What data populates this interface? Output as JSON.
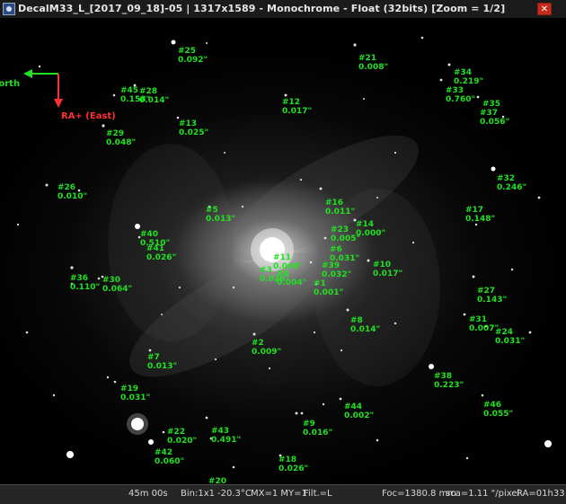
{
  "window": {
    "title": "DecalM33_L_[2017_09_18]-05 | 1317x1589 - Monochrome - Float (32bits)   [Zoom = 1/2]",
    "close_label": "✕"
  },
  "compass": {
    "north_label": "North",
    "east_label": "RA+ (East)",
    "north_color": "#22e022",
    "east_color": "#ff3030"
  },
  "stars": [
    {
      "id": "#25",
      "value": "0.092\""
    },
    {
      "id": "#21",
      "value": "0.008\""
    },
    {
      "id": "#34",
      "value": "0.219\""
    },
    {
      "id": "#33",
      "value": "0.760\""
    },
    {
      "id": "#35",
      "value": ""
    },
    {
      "id": "#37",
      "value": "0.056\""
    },
    {
      "id": "#45",
      "value": "0.158\""
    },
    {
      "id": "#28",
      "value": "0.014\""
    },
    {
      "id": "#12",
      "value": "0.017\""
    },
    {
      "id": "#13",
      "value": "0.025\""
    },
    {
      "id": "#29",
      "value": "0.048\""
    },
    {
      "id": "#32",
      "value": "0.246\""
    },
    {
      "id": "#26",
      "value": "0.010\""
    },
    {
      "id": "#16",
      "value": "0.011\""
    },
    {
      "id": "#5",
      "value": "0.013\""
    },
    {
      "id": "#17",
      "value": "0.148\""
    },
    {
      "id": "#14",
      "value": "0.000\""
    },
    {
      "id": "#23",
      "value": "0.005\""
    },
    {
      "id": "#40",
      "value": "0.510\""
    },
    {
      "id": "#41",
      "value": "0.026\""
    },
    {
      "id": "#6",
      "value": "0.031\""
    },
    {
      "id": "#11",
      "value": "0.008\""
    },
    {
      "id": "#39",
      "value": "0.032\""
    },
    {
      "id": "#10",
      "value": "0.017\""
    },
    {
      "id": "#3",
      "value": "0.026\""
    },
    {
      "id": "#4",
      "value": "0.004\""
    },
    {
      "id": "#36",
      "value": "0.110\""
    },
    {
      "id": "#30",
      "value": "0.064\""
    },
    {
      "id": "#1",
      "value": "0.001\""
    },
    {
      "id": "#27",
      "value": "0.143\""
    },
    {
      "id": "#8",
      "value": "0.014\""
    },
    {
      "id": "#31",
      "value": "0.007\""
    },
    {
      "id": "#24",
      "value": "0.031\""
    },
    {
      "id": "#2",
      "value": "0.009\""
    },
    {
      "id": "#7",
      "value": "0.013\""
    },
    {
      "id": "#38",
      "value": "0.223\""
    },
    {
      "id": "#19",
      "value": "0.031\""
    },
    {
      "id": "#46",
      "value": "0.055\""
    },
    {
      "id": "#44",
      "value": "0.002\""
    },
    {
      "id": "#9",
      "value": "0.016\""
    },
    {
      "id": "#22",
      "value": "0.020\""
    },
    {
      "id": "#43",
      "value": "0.491\""
    },
    {
      "id": "#42",
      "value": "0.060\""
    },
    {
      "id": "#18",
      "value": "0.026\""
    },
    {
      "id": "#20",
      "value": ""
    }
  ],
  "status": {
    "exposure": "45m 00s",
    "binning": "Bin:1x1",
    "temperature": "-20.3°C",
    "mx_my": "MX=1 MY=1",
    "filter": "Filt.=L",
    "focal": "Foc=1380.8 mm",
    "scale": "sca=1.11 \"/pixel",
    "ra": "RA=01h33"
  }
}
